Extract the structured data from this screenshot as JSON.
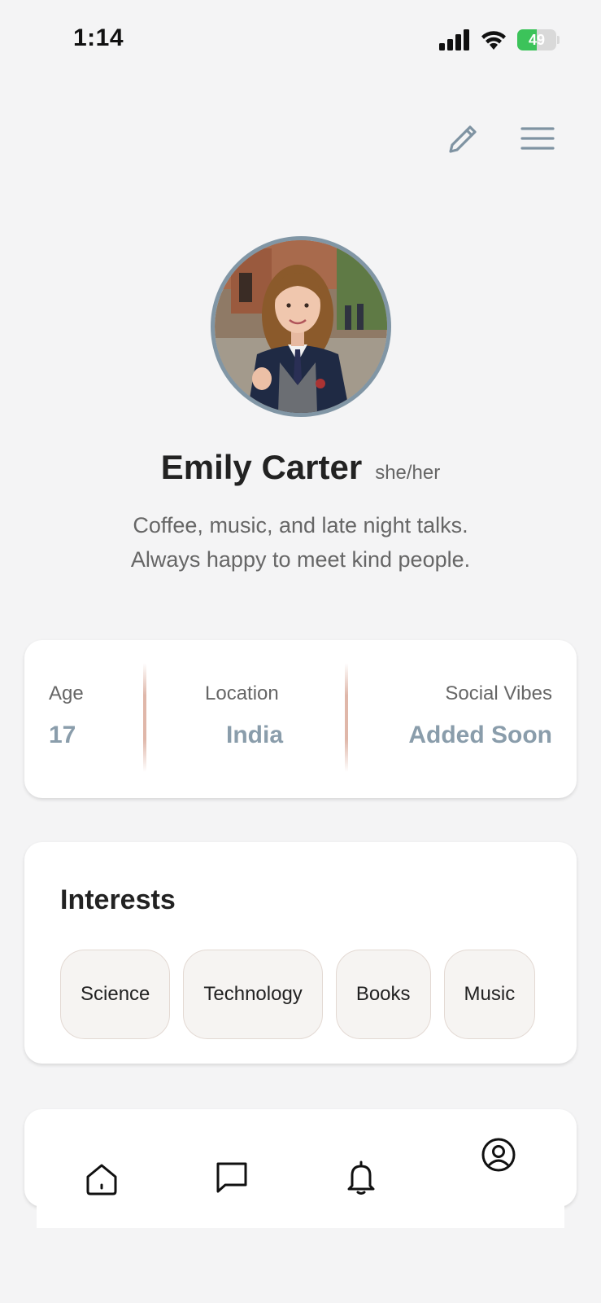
{
  "status_bar": {
    "time": "1:14",
    "battery_percent": "49",
    "battery_level": 0.49,
    "battery_color": "#3cc35a"
  },
  "header": {
    "edit_icon": "pencil-icon",
    "menu_icon": "hamburger-menu-icon"
  },
  "profile": {
    "name": "Emily Carter",
    "pronouns": "she/her",
    "bio_line_1": "Coffee, music, and late night talks.",
    "bio_line_2": "Always happy to meet kind people."
  },
  "info": {
    "age_label": "Age",
    "age_value": "17",
    "location_label": "Location",
    "location_value": "India",
    "vibes_label": "Social Vibes",
    "vibes_value": "Added Soon"
  },
  "interests": {
    "title": "Interests",
    "items": [
      "Science",
      "Technology",
      "Books",
      "Music"
    ]
  },
  "nav": {
    "items": [
      "home-icon",
      "chat-icon",
      "bell-icon",
      "profile-icon"
    ],
    "active": "profile-icon"
  },
  "colors": {
    "accent": "#8a9dab",
    "avatar_border": "#8196a5",
    "background": "#f4f4f5"
  }
}
